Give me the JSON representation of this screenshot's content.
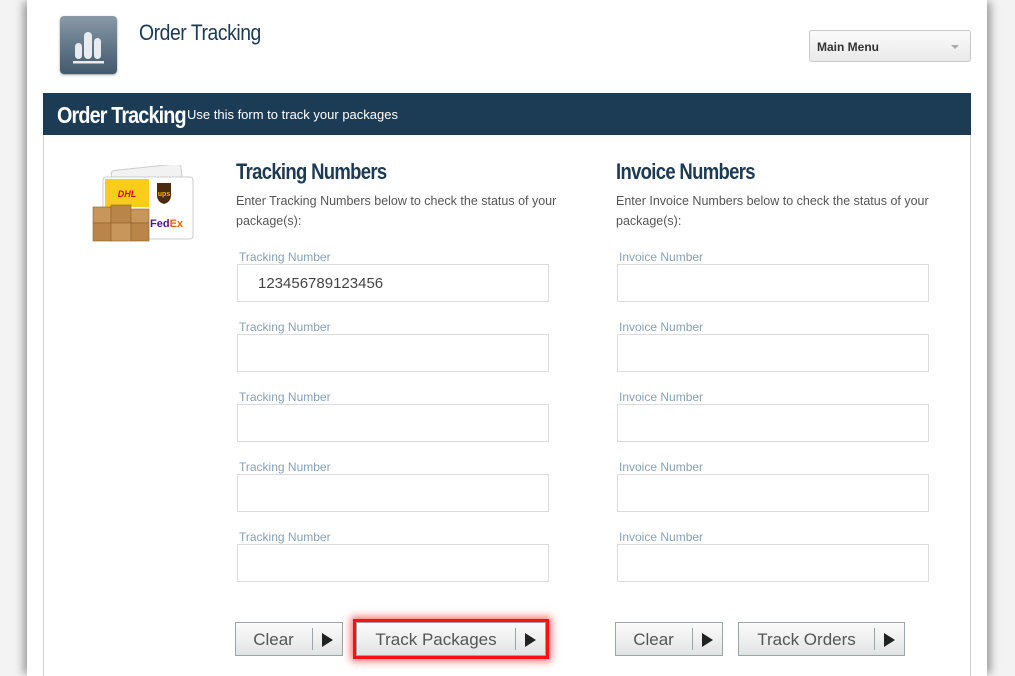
{
  "header": {
    "app_title": "Order Tracking",
    "app_icon": "bar-chart-icon",
    "main_menu": {
      "label": "Main Menu",
      "icon": "chevron-down-icon"
    }
  },
  "banner": {
    "title": "Order Tracking",
    "subtitle": "Use this form to track your packages"
  },
  "carrier_logo": {
    "carriers": [
      "DHL",
      "UPS",
      "FedEx"
    ]
  },
  "tracking": {
    "heading": "Tracking Numbers",
    "description": "Enter Tracking Numbers below to check the status of your package(s):",
    "fields": [
      {
        "label": "Tracking Number",
        "value": "123456789123456"
      },
      {
        "label": "Tracking Number",
        "value": ""
      },
      {
        "label": "Tracking Number",
        "value": ""
      },
      {
        "label": "Tracking Number",
        "value": ""
      },
      {
        "label": "Tracking Number",
        "value": ""
      }
    ],
    "clear_label": "Clear",
    "submit_label": "Track Packages"
  },
  "invoice": {
    "heading": "Invoice Numbers",
    "description": "Enter Invoice Numbers below to check the status of your package(s):",
    "fields": [
      {
        "label": "Invoice Number",
        "value": ""
      },
      {
        "label": "Invoice Number",
        "value": ""
      },
      {
        "label": "Invoice Number",
        "value": ""
      },
      {
        "label": "Invoice Number",
        "value": ""
      },
      {
        "label": "Invoice Number",
        "value": ""
      }
    ],
    "clear_label": "Clear",
    "submit_label": "Track Orders"
  },
  "colors": {
    "banner": "#1c3b54",
    "heading": "#1d3a52",
    "field_label": "#87a1b4",
    "highlight": "#ff1010"
  }
}
